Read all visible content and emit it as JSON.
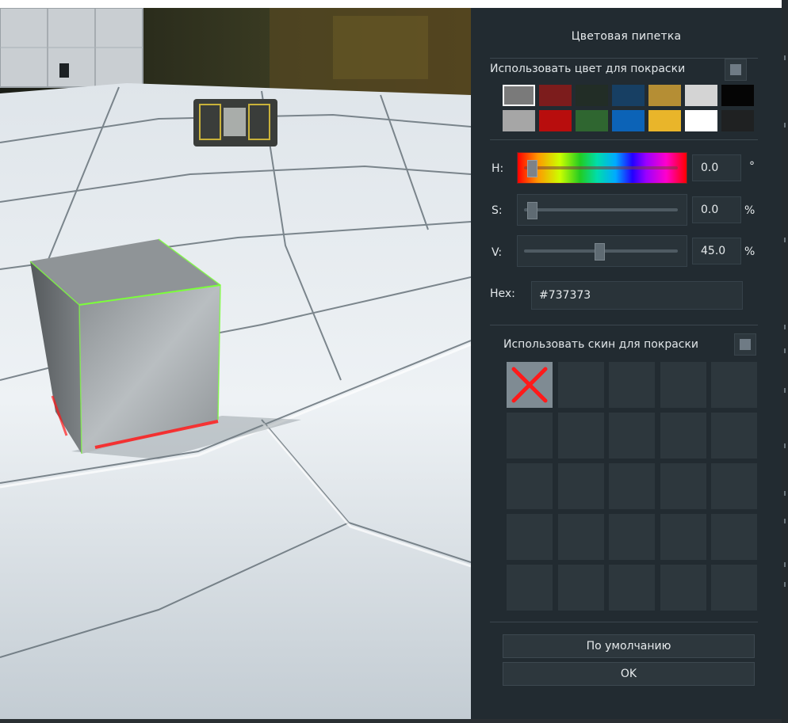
{
  "panel": {
    "title": "Цветовая пипетка",
    "use_color_label": "Использовать цвет для покраски",
    "use_color_checked": false,
    "swatches": [
      [
        "#7a7a7a",
        "#7c1c1c",
        "#222d26",
        "#173f63",
        "#b58e34",
        "#d4d4d4",
        "#050505"
      ],
      [
        "#a6a6a6",
        "#b80d0d",
        "#2f6630",
        "#0c63b7",
        "#e9b52a",
        "#ffffff",
        "#1f2122"
      ]
    ],
    "selected_swatch": [
      0,
      0
    ],
    "sliders": {
      "h": {
        "label": "H:",
        "value_text": "0.0",
        "unit": "°",
        "fraction": 0.0
      },
      "s": {
        "label": "S:",
        "value_text": "0.0",
        "unit": "%",
        "fraction": 0.0
      },
      "v": {
        "label": "V:",
        "value_text": "45.0",
        "unit": "%",
        "fraction": 0.45
      }
    },
    "hex": {
      "label": "Hex:",
      "value": "#737373"
    },
    "use_skin_label": "Использовать скин для покраски",
    "use_skin_checked": false,
    "skins": {
      "rows": 5,
      "cols": 5,
      "selected_index": 0,
      "selected_icon": "red-cross-icon"
    },
    "buttons": {
      "default_label": "По умолчанию",
      "ok_label": "OK"
    }
  },
  "colors": {
    "panel_bg": "#222b31",
    "accent_red": "#ff1a1a",
    "highlight_green": "#7cff3a"
  }
}
